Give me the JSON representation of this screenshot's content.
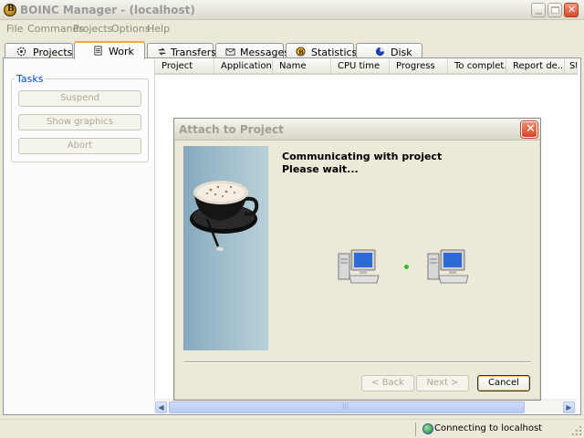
{
  "window": {
    "title": "BOINC Manager - (localhost)"
  },
  "menu": [
    "File",
    "Commands",
    "Projects",
    "Options",
    "Help"
  ],
  "tabs": [
    {
      "label": "Projects",
      "icon": "gear-icon",
      "active": false
    },
    {
      "label": "Work",
      "icon": "document-icon",
      "active": true
    },
    {
      "label": "Transfers",
      "icon": "transfer-icon",
      "active": false
    },
    {
      "label": "Messages",
      "icon": "envelope-icon",
      "active": false
    },
    {
      "label": "Statistics",
      "icon": "boinc-icon",
      "active": false
    },
    {
      "label": "Disk",
      "icon": "pie-chart-icon",
      "active": false
    }
  ],
  "tasks": {
    "label": "Tasks",
    "buttons": [
      "Suspend",
      "Show graphics",
      "Abort"
    ]
  },
  "work_list": {
    "columns": [
      "Project",
      "Application",
      "Name",
      "CPU time",
      "Progress",
      "To complet...",
      "Report de...",
      "St"
    ]
  },
  "status": {
    "text": "Connecting to localhost",
    "icon": "network-icon"
  },
  "dialog": {
    "title": "Attach to Project",
    "message_line1": "Communicating with project",
    "message_line2": "Please wait...",
    "buttons": {
      "back": "< Back",
      "next": "Next >",
      "cancel": "Cancel"
    },
    "activity_dot_color": "#3cb828"
  }
}
